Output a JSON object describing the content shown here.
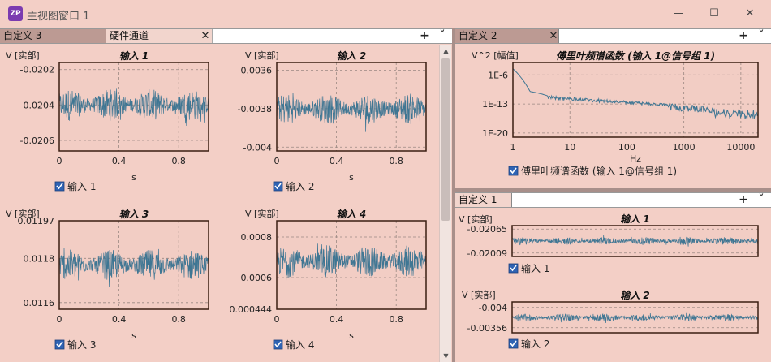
{
  "window": {
    "logo": "ZP",
    "title": "主视图窗口 1",
    "min_icon": "minimize-icon",
    "max_icon": "maximize-icon",
    "close_icon": "close-icon"
  },
  "panes": {
    "left": {
      "tabs": [
        {
          "label": "自定义 3",
          "active": true
        },
        {
          "label": "硬件通道",
          "active": false
        }
      ],
      "add_label": "+",
      "menu_label": "⌄"
    },
    "right_top": {
      "tabs": [
        {
          "label": "自定义 2",
          "active": true
        }
      ],
      "add_label": "+",
      "menu_label": "⌄"
    },
    "right_bottom": {
      "tabs": [
        {
          "label": "自定义 1",
          "active": true
        }
      ],
      "add_label": "+",
      "menu_label": "⌄"
    }
  },
  "colors": {
    "trace": "#3f7693",
    "plot_bg": "#f2cdc4",
    "frame": "#3a1e12",
    "grid": "#9a8882",
    "checkbox": "#2f63b3"
  },
  "chart_data": [
    {
      "type": "line",
      "title": "输入 1",
      "ylabel": "V [实部]",
      "xlabel": "s",
      "xlim": [
        0,
        1
      ],
      "ylim": [
        -0.02066,
        -0.02016
      ],
      "xticks": [
        0,
        0.4,
        0.8
      ],
      "yticks": [
        -0.0202,
        -0.0204,
        -0.0206
      ],
      "series": [
        {
          "name": "输入 1",
          "center": -0.0204,
          "noise": 9e-05
        }
      ],
      "legend": "输入 1"
    },
    {
      "type": "line",
      "title": "输入 2",
      "ylabel": "V [实部]",
      "xlabel": "s",
      "xlim": [
        0,
        1
      ],
      "ylim": [
        -0.00402,
        -0.00356
      ],
      "xticks": [
        0,
        0.4,
        0.8
      ],
      "yticks": [
        -0.0036,
        -0.0038,
        -0.004
      ],
      "series": [
        {
          "name": "输入 2",
          "center": -0.0038,
          "noise": 8e-05
        }
      ],
      "legend": "输入 2"
    },
    {
      "type": "line",
      "title": "输入 3",
      "ylabel": "V [实部]",
      "xlabel": "s",
      "xlim": [
        0,
        1
      ],
      "ylim": [
        0.01157,
        0.01197
      ],
      "xticks": [
        0,
        0.4,
        0.8
      ],
      "yticks": [
        0.01197,
        0.0118,
        0.0116
      ],
      "series": [
        {
          "name": "输入 3",
          "center": 0.01177,
          "noise": 7e-05
        }
      ],
      "legend": "输入 3"
    },
    {
      "type": "line",
      "title": "输入 4",
      "ylabel": "V [实部]",
      "xlabel": "s",
      "xlim": [
        0,
        1
      ],
      "ylim": [
        0.000444,
        0.00088
      ],
      "xticks": [
        0,
        0.4,
        0.8
      ],
      "yticks": [
        0.0008,
        0.0006,
        0.000444
      ],
      "series": [
        {
          "name": "输入 4",
          "center": 0.00068,
          "noise": 8e-05
        }
      ],
      "legend": "输入 4"
    },
    {
      "type": "line",
      "title": "傅里叶频谱函数 (输入 1@信号组 1)",
      "ylabel": "V^2 [幅值]",
      "xlabel": "Hz",
      "xscale": "log",
      "yscale": "log",
      "xlim": [
        1,
        20000
      ],
      "ylim_exp": [
        -21,
        -3
      ],
      "xticks": [
        1,
        10,
        100,
        1000,
        10000
      ],
      "yticks": [
        "1E-6",
        "1E-13",
        "1E-20"
      ],
      "series": [
        {
          "name": "傅里叶频谱函数 (输入 1@信号组 1)"
        }
      ],
      "legend": "傅里叶频谱函数 (输入 1@信号组 1)"
    },
    {
      "type": "line",
      "title": "输入 1",
      "ylabel": "V [实部]",
      "xlabel": "",
      "xlim": [
        0,
        1
      ],
      "ylim": [
        -0.02001,
        -0.02073
      ],
      "yticks": [
        -0.02009,
        -0.02065
      ],
      "series": [
        {
          "name": "输入 1",
          "center": -0.02037,
          "noise": 9e-05
        }
      ],
      "legend": "输入 1"
    },
    {
      "type": "line",
      "title": "输入 2",
      "ylabel": "V [实部]",
      "xlabel": "",
      "xlim": [
        0,
        1
      ],
      "ylim": [
        -0.00345,
        -0.00412
      ],
      "yticks": [
        -0.00356,
        -0.004
      ],
      "series": [
        {
          "name": "输入 2",
          "center": -0.00378,
          "noise": 8e-05
        }
      ],
      "legend": "输入 2"
    }
  ]
}
